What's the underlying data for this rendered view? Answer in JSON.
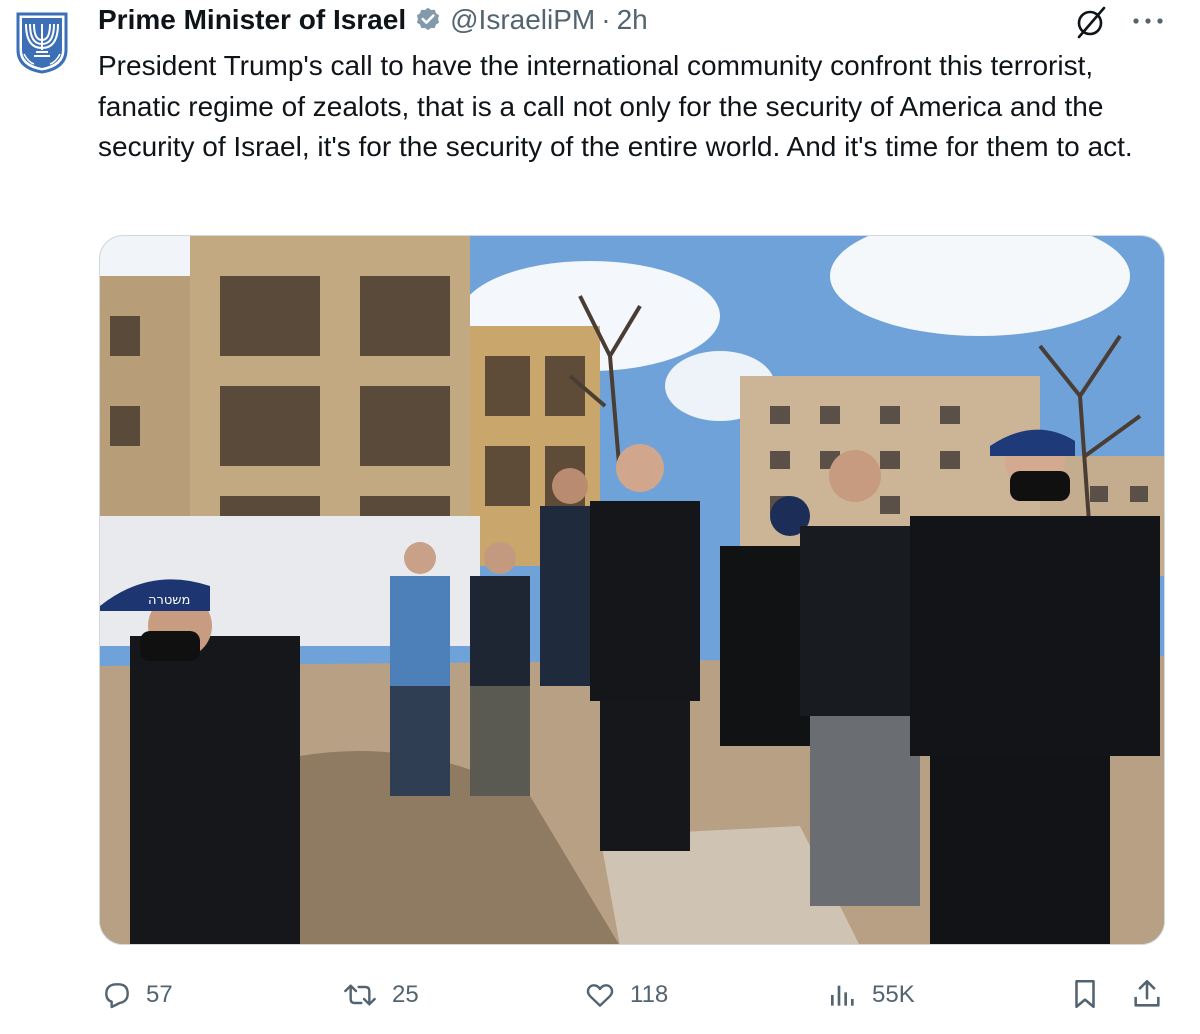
{
  "tweet": {
    "author_name": "Prime Minister of Israel",
    "handle": "@IsraeliPM",
    "separator": "·",
    "time": "2h",
    "text": "President Trump's call to have the international community confront this terrorist, fanatic regime of zealots, that is a call not only for the security of America and the security of Israel, it's for the security of the entire world. And it's time for them to act.",
    "avatar_icon": "menorah-emblem-icon",
    "verified_icon": "verified-badge-icon"
  },
  "media": {
    "description_icon": "photo-image",
    "cap_text": "משטרה"
  },
  "actions": {
    "replies": "57",
    "reposts": "25",
    "likes": "118",
    "views": "55K"
  },
  "colors": {
    "text": "#0f1419",
    "secondary": "#536471",
    "accent": "#1d9bf0",
    "emblem": "#3b6fb6"
  }
}
